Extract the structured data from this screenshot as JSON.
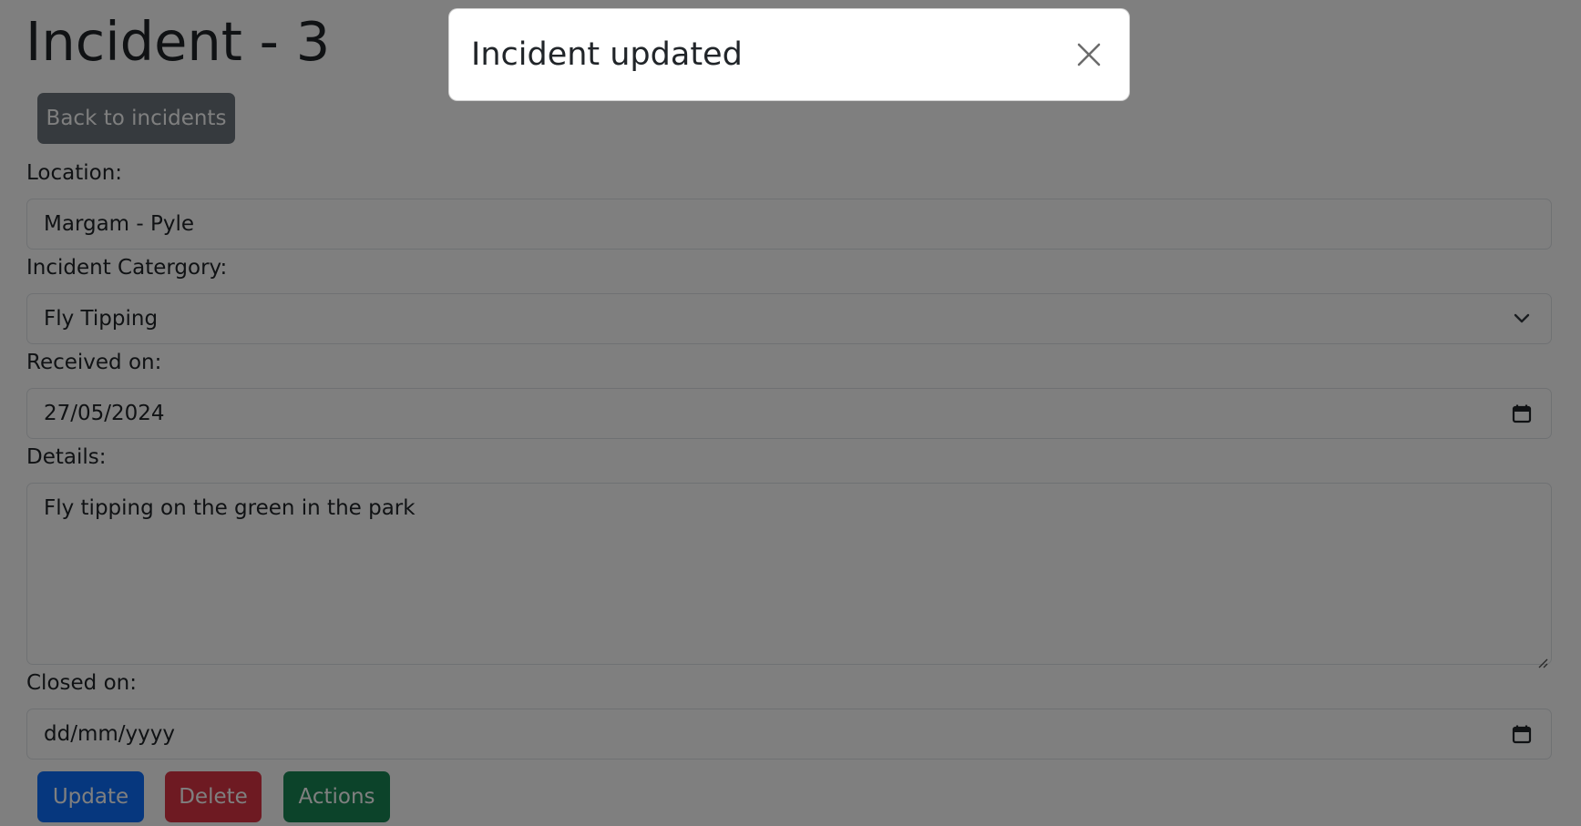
{
  "page": {
    "title": "Incident - 3",
    "back_button": "Back to incidents"
  },
  "form": {
    "location": {
      "label": "Location:",
      "value": "Margam - Pyle"
    },
    "category": {
      "label": "Incident Catergory:",
      "value": "Fly Tipping"
    },
    "received_on": {
      "label": "Received on:",
      "value": "27/05/2024"
    },
    "details": {
      "label": "Details:",
      "value": "Fly tipping on the green in the park"
    },
    "closed_on": {
      "label": "Closed on:",
      "placeholder": "dd/mm/yyyy"
    }
  },
  "actions": {
    "update": "Update",
    "delete": "Delete",
    "actions": "Actions"
  },
  "modal": {
    "title": "Incident updated",
    "close_icon": "close-icon"
  },
  "colors": {
    "primary": "#0d6efd",
    "danger": "#dc3545",
    "success": "#198754",
    "secondary": "#6c757d",
    "backdrop": "rgba(0,0,0,0.5)"
  }
}
